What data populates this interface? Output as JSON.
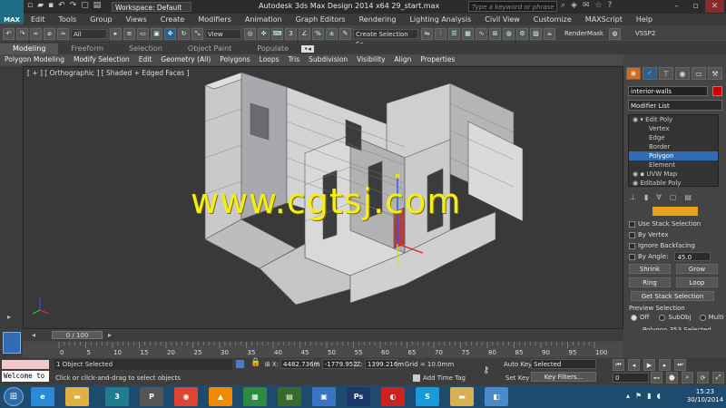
{
  "titlebar": {
    "logo": "MAX",
    "workspace": "Workspace: Default",
    "title": "Autodesk 3ds Max Design 2014 x64     29_start.max",
    "search_placeholder": "Type a keyword or phrase"
  },
  "menubar": [
    "Edit",
    "Tools",
    "Group",
    "Views",
    "Create",
    "Modifiers",
    "Animation",
    "Graph Editors",
    "Rendering",
    "Lighting Analysis",
    "Civil View",
    "Customize",
    "MAXScript",
    "Help"
  ],
  "toolbar": {
    "selection_filter": "All",
    "ref_coord": "View",
    "named_selection": "Create Selection Se",
    "render_mask": "RenderMask",
    "vssp": "VSSP2"
  },
  "ribbon": {
    "tabs": [
      "Modeling",
      "Freeform",
      "Selection",
      "Object Paint",
      "Populate"
    ],
    "active_tab": "Modeling",
    "subitems": [
      "Polygon Modeling",
      "Modify Selection",
      "Edit",
      "Geometry (All)",
      "Polygons",
      "Loops",
      "Tris",
      "Subdivision",
      "Visibility",
      "Align",
      "Properties"
    ]
  },
  "viewport": {
    "label": "[ + ] [ Orthographic ] [ Shaded + Edged Faces ]",
    "watermark": "www.cgtsj.com"
  },
  "command_panel": {
    "object_name": "interior-walls",
    "object_color": "#cc0000",
    "modifier_list": "Modifier List",
    "stack": [
      {
        "label": "Edit Poly",
        "level": 0,
        "selected": false
      },
      {
        "label": "Vertex",
        "level": 1,
        "selected": false
      },
      {
        "label": "Edge",
        "level": 1,
        "selected": false
      },
      {
        "label": "Border",
        "level": 1,
        "selected": false
      },
      {
        "label": "Polygon",
        "level": 1,
        "selected": true
      },
      {
        "label": "Element",
        "level": 1,
        "selected": false
      },
      {
        "label": "UVW Map",
        "level": 0,
        "selected": false
      },
      {
        "label": "Editable Poly",
        "level": 0,
        "selected": false
      }
    ],
    "use_stack_selection": "Use Stack Selection",
    "by_vertex": "By Vertex",
    "ignore_backfacing": "Ignore Backfacing",
    "by_angle": "By Angle:",
    "by_angle_value": "45.0",
    "shrink": "Shrink",
    "grow": "Grow",
    "ring": "Ring",
    "loop": "Loop",
    "get_stack_selection": "Get Stack Selection",
    "preview_selection": "Preview Selection",
    "preview_off": "Off",
    "preview_subobj": "SubObj",
    "preview_multi": "Multi",
    "polygon_status": "Polygon 353 Selected"
  },
  "timeline": {
    "frame_display": "0 / 100",
    "ticks": [
      "0",
      "5",
      "10",
      "15",
      "20",
      "25",
      "30",
      "35",
      "40",
      "45",
      "50",
      "55",
      "60",
      "65",
      "70",
      "75",
      "80",
      "85",
      "90",
      "95",
      "100"
    ]
  },
  "status": {
    "maxscript": "Welcome to",
    "selection": "1 Object Selected",
    "prompt": "Click or click-and-drag to select objects",
    "x_label": "X:",
    "x_value": "4482.736m",
    "y_label": "Y:",
    "y_value": "-1779.952",
    "z_label": "Z:",
    "z_value": "1399.216m",
    "grid": "Grid = 10.0mm",
    "auto_key": "Auto Key",
    "selected": "Selected",
    "set_key": "Set Key",
    "key_filters": "Key Filters...",
    "add_time_tag": "Add Time Tag",
    "frame_field": "0"
  },
  "taskbar": {
    "time": "15:23",
    "date": "30/10/2014",
    "apps": [
      {
        "name": "ie-icon",
        "glyph": "e",
        "color": "#2a8ad8"
      },
      {
        "name": "explorer-icon",
        "glyph": "▬",
        "color": "#e0b040"
      },
      {
        "name": "3dsmax-icon",
        "glyph": "3",
        "color": "#1f7e8e"
      },
      {
        "name": "pixologic-icon",
        "glyph": "P",
        "color": "#555555"
      },
      {
        "name": "chrome-icon",
        "glyph": "◉",
        "color": "#dd4433"
      },
      {
        "name": "vlc-icon",
        "glyph": "▲",
        "color": "#f08a00"
      },
      {
        "name": "camtasia-icon",
        "glyph": "▦",
        "color": "#2d8a3e"
      },
      {
        "name": "bandicam-icon",
        "glyph": "▤",
        "color": "#3a6a2a"
      },
      {
        "name": "network-icon",
        "glyph": "▣",
        "color": "#3a74c4"
      },
      {
        "name": "photoshop-icon",
        "glyph": "Ps",
        "color": "#1b3a6a"
      },
      {
        "name": "adobe-cc-icon",
        "glyph": "◐",
        "color": "#cc2222"
      },
      {
        "name": "skype-icon",
        "glyph": "S",
        "color": "#1a9ad8"
      },
      {
        "name": "folder-icon",
        "glyph": "▬",
        "color": "#d8b050"
      },
      {
        "name": "app-icon",
        "glyph": "◧",
        "color": "#4a8ac8"
      }
    ]
  }
}
